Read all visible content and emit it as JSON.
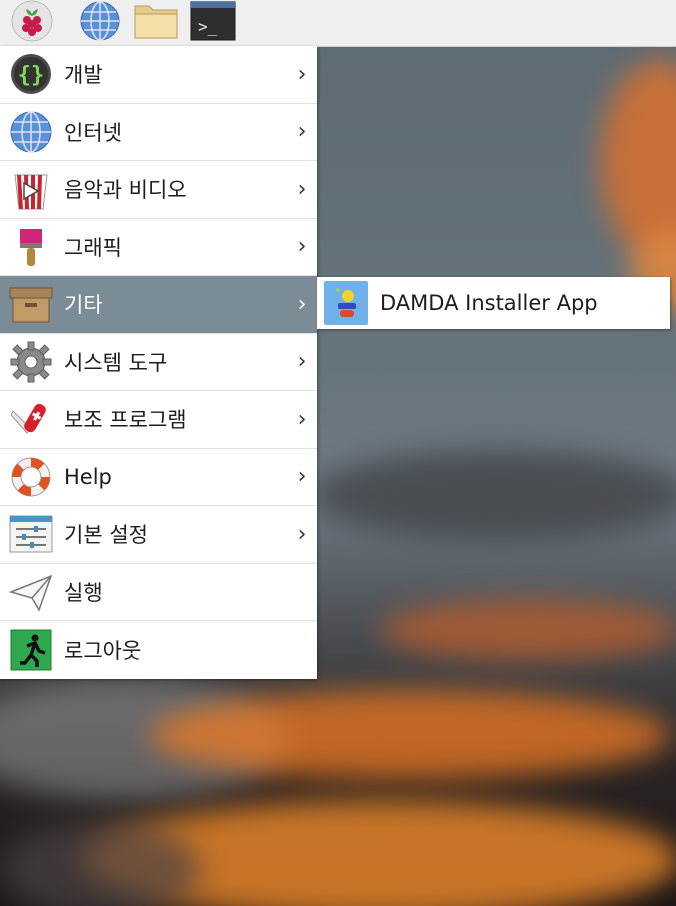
{
  "taskbar": {
    "buttons": [
      {
        "name": "raspberry-menu-button",
        "icon": "raspberry-icon"
      },
      {
        "name": "web-browser-button",
        "icon": "globe-icon"
      },
      {
        "name": "file-manager-button",
        "icon": "folder-icon"
      },
      {
        "name": "terminal-button",
        "icon": "terminal-icon",
        "text": ">_"
      }
    ]
  },
  "menu": {
    "items": [
      {
        "label": "개발",
        "icon": "code-braces-icon",
        "submenu": true
      },
      {
        "label": "인터넷",
        "icon": "globe-icon",
        "submenu": true
      },
      {
        "label": "음악과 비디오",
        "icon": "popcorn-video-icon",
        "submenu": true
      },
      {
        "label": "그래픽",
        "icon": "paintbrush-icon",
        "submenu": true
      },
      {
        "label": "기타",
        "icon": "box-icon",
        "submenu": true,
        "selected": true
      },
      {
        "label": "시스템 도구",
        "icon": "gear-icon",
        "submenu": true
      },
      {
        "label": "보조 프로그램",
        "icon": "pocket-knife-icon",
        "submenu": true
      },
      {
        "label": "Help",
        "icon": "lifebuoy-icon",
        "submenu": true
      },
      {
        "label": "기본 설정",
        "icon": "settings-sliders-icon",
        "submenu": true
      },
      {
        "label": "실행",
        "icon": "paper-plane-icon",
        "submenu": false
      },
      {
        "label": "로그아웃",
        "icon": "exit-running-icon",
        "submenu": false
      }
    ],
    "chevron": "›"
  },
  "submenu": {
    "items": [
      {
        "label": "DAMDA Installer App",
        "icon": "damda-app-icon"
      }
    ]
  },
  "colors": {
    "selected_bg": "#7c8c97",
    "menu_bg": "#ffffff",
    "taskbar_bg": "#efefef"
  }
}
